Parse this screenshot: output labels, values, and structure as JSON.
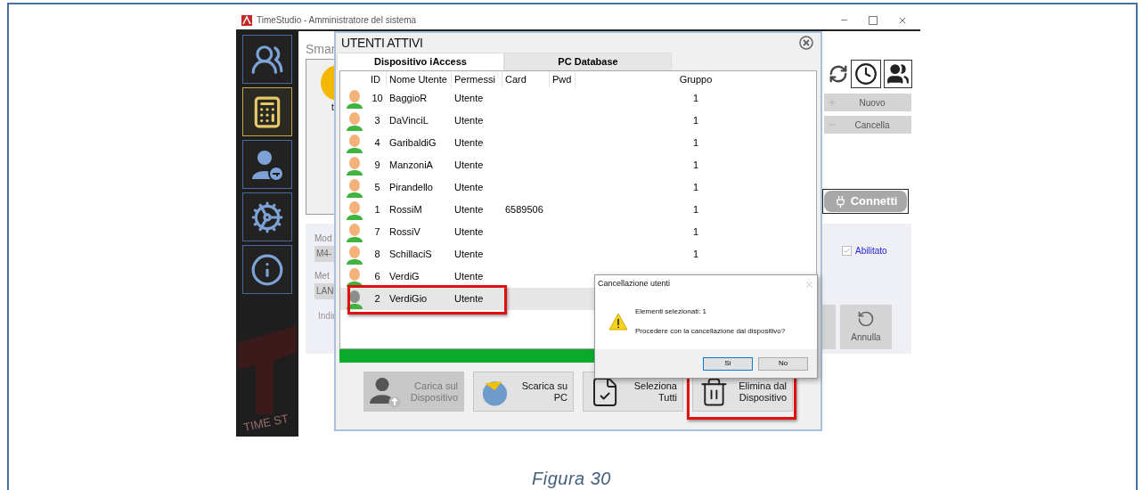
{
  "document": {
    "caption": "Figura 30"
  },
  "app": {
    "title": "TimeStudio - Amministratore del sistema",
    "sidebar": [
      {
        "selected": false
      },
      {
        "selected": true
      },
      {
        "selected": false
      },
      {
        "selected": false
      },
      {
        "selected": false
      }
    ],
    "logo_text": "TIME ST",
    "background": {
      "heading": "Smar",
      "letter": "t",
      "fields": [
        {
          "label": "Mod",
          "value": "M4-"
        },
        {
          "label": "Met",
          "value": "LAN"
        }
      ],
      "address_label": "Indir"
    },
    "right_panel": {
      "buttons": [
        {
          "kind": "add",
          "label": "Nuovo"
        },
        {
          "kind": "remove",
          "label": "Cancella"
        }
      ],
      "connect": "Connetti",
      "enabled": {
        "label": "Abilitato",
        "checked": true
      },
      "undo": "Annulla"
    }
  },
  "users_dialog": {
    "title": "UTENTI ATTIVI",
    "tabs": [
      {
        "label": "Dispositivo iAccess",
        "selected": true
      },
      {
        "label": "PC Database",
        "selected": false
      }
    ],
    "columns": [
      "ID",
      "Nome Utente",
      "Permessi",
      "Card",
      "Pwd",
      "Gruppo"
    ],
    "rows": [
      {
        "id": "10",
        "name": "BaggioR",
        "permission": "Utente",
        "card": "",
        "group": "1",
        "selected": false,
        "highlighted": false
      },
      {
        "id": "3",
        "name": "DaVinciL",
        "permission": "Utente",
        "card": "",
        "group": "1",
        "selected": false,
        "highlighted": false
      },
      {
        "id": "4",
        "name": "GaribaldiG",
        "permission": "Utente",
        "card": "",
        "group": "1",
        "selected": false,
        "highlighted": false
      },
      {
        "id": "9",
        "name": "ManzoniA",
        "permission": "Utente",
        "card": "",
        "group": "1",
        "selected": false,
        "highlighted": false
      },
      {
        "id": "5",
        "name": "Pirandello",
        "permission": "Utente",
        "card": "",
        "group": "1",
        "selected": false,
        "highlighted": false
      },
      {
        "id": "1",
        "name": "RossiM",
        "permission": "Utente",
        "card": "6589506",
        "group": "1",
        "selected": false,
        "highlighted": false
      },
      {
        "id": "7",
        "name": "RossiV",
        "permission": "Utente",
        "card": "",
        "group": "1",
        "selected": false,
        "highlighted": false
      },
      {
        "id": "8",
        "name": "SchillaciS",
        "permission": "Utente",
        "card": "",
        "group": "1",
        "selected": false,
        "highlighted": false
      },
      {
        "id": "6",
        "name": "VerdiG",
        "permission": "Utente",
        "card": "",
        "group": "",
        "selected": false,
        "highlighted": false
      },
      {
        "id": "2",
        "name": "VerdiGio",
        "permission": "Utente",
        "card": "",
        "group": "",
        "selected": true,
        "highlighted": true
      }
    ],
    "progress": {
      "level": 1
    },
    "actions": [
      {
        "kind": "upload",
        "label": "Carica sul Dispositivo",
        "disabled": true,
        "highlighted": false
      },
      {
        "kind": "download",
        "label": "Scarica su PC",
        "disabled": false,
        "highlighted": false
      },
      {
        "kind": "select",
        "label": "Seleziona Tutti",
        "disabled": false,
        "highlighted": false
      },
      {
        "kind": "delete",
        "label": "Elimina dal Dispositivo",
        "disabled": false,
        "highlighted": true
      }
    ]
  },
  "confirm_dialog": {
    "title": "Cancellazione utenti",
    "lines": [
      "Elementi selezionati: 1",
      "Procedere con la cancellazione dal dispositivo?"
    ],
    "buttons": [
      {
        "label": "Sì",
        "selected": true
      },
      {
        "label": "No",
        "selected": false
      }
    ]
  }
}
